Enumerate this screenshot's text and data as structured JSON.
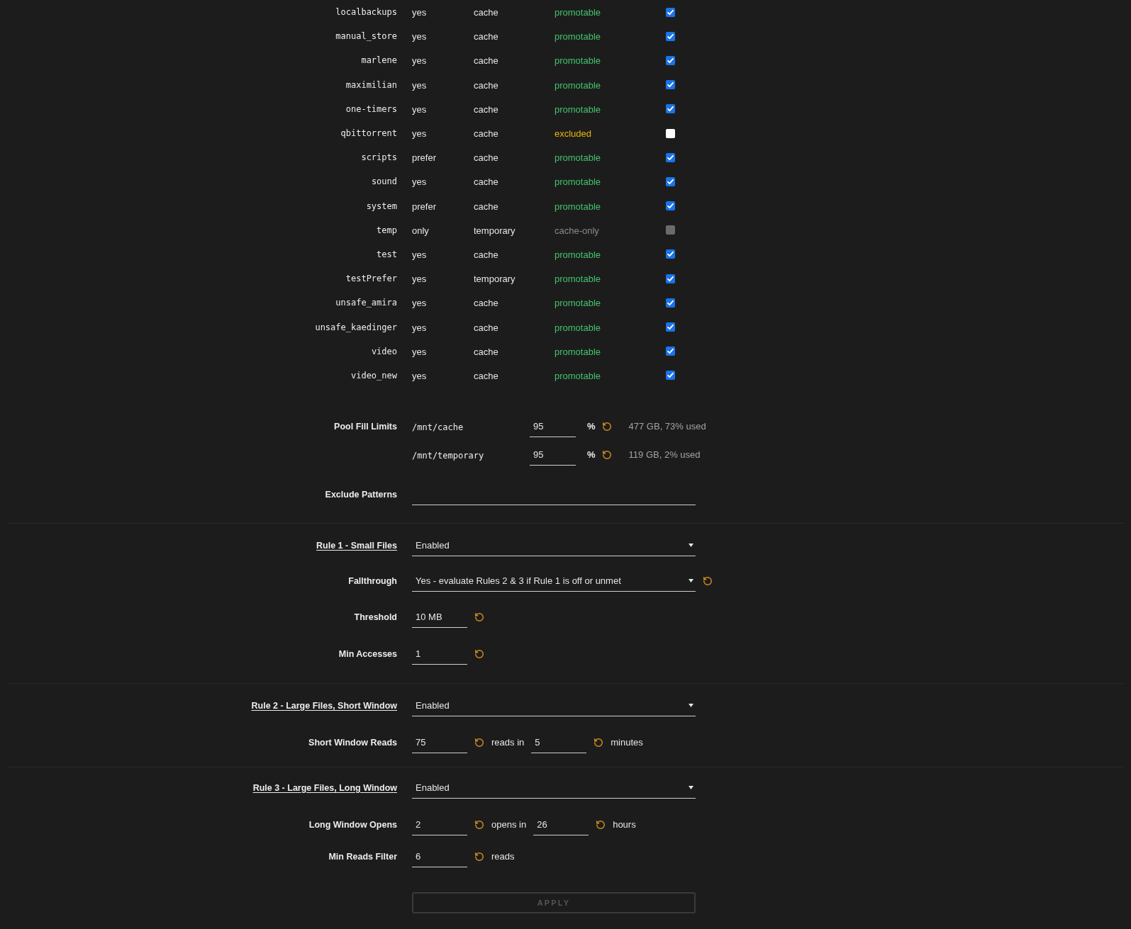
{
  "shares": [
    {
      "name": "localbackups",
      "use_cache": "yes",
      "pool": "cache",
      "status": "promotable",
      "color": "#42c46a",
      "checked": true,
      "disabled": false
    },
    {
      "name": "manual_store",
      "use_cache": "yes",
      "pool": "cache",
      "status": "promotable",
      "color": "#42c46a",
      "checked": true,
      "disabled": false
    },
    {
      "name": "marlene",
      "use_cache": "yes",
      "pool": "cache",
      "status": "promotable",
      "color": "#42c46a",
      "checked": true,
      "disabled": false
    },
    {
      "name": "maximilian",
      "use_cache": "yes",
      "pool": "cache",
      "status": "promotable",
      "color": "#42c46a",
      "checked": true,
      "disabled": false
    },
    {
      "name": "one-timers",
      "use_cache": "yes",
      "pool": "cache",
      "status": "promotable",
      "color": "#42c46a",
      "checked": true,
      "disabled": false
    },
    {
      "name": "qbittorrent",
      "use_cache": "yes",
      "pool": "cache",
      "status": "excluded",
      "color": "#e8b80c",
      "checked": false,
      "disabled": false
    },
    {
      "name": "scripts",
      "use_cache": "prefer",
      "pool": "cache",
      "status": "promotable",
      "color": "#42c46a",
      "checked": true,
      "disabled": false
    },
    {
      "name": "sound",
      "use_cache": "yes",
      "pool": "cache",
      "status": "promotable",
      "color": "#42c46a",
      "checked": true,
      "disabled": false
    },
    {
      "name": "system",
      "use_cache": "prefer",
      "pool": "cache",
      "status": "promotable",
      "color": "#42c46a",
      "checked": true,
      "disabled": false
    },
    {
      "name": "temp",
      "use_cache": "only",
      "pool": "temporary",
      "status": "cache-only",
      "color": "#8a8a8a",
      "checked": false,
      "disabled": true
    },
    {
      "name": "test",
      "use_cache": "yes",
      "pool": "cache",
      "status": "promotable",
      "color": "#42c46a",
      "checked": true,
      "disabled": false
    },
    {
      "name": "testPrefer",
      "use_cache": "yes",
      "pool": "temporary",
      "status": "promotable",
      "color": "#42c46a",
      "checked": true,
      "disabled": false
    },
    {
      "name": "unsafe_amira",
      "use_cache": "yes",
      "pool": "cache",
      "status": "promotable",
      "color": "#42c46a",
      "checked": true,
      "disabled": false
    },
    {
      "name": "unsafe_kaedinger",
      "use_cache": "yes",
      "pool": "cache",
      "status": "promotable",
      "color": "#42c46a",
      "checked": true,
      "disabled": false
    },
    {
      "name": "video",
      "use_cache": "yes",
      "pool": "cache",
      "status": "promotable",
      "color": "#42c46a",
      "checked": true,
      "disabled": false
    },
    {
      "name": "video_new",
      "use_cache": "yes",
      "pool": "cache",
      "status": "promotable",
      "color": "#42c46a",
      "checked": true,
      "disabled": false
    }
  ],
  "pool_fill_limits": {
    "label": "Pool Fill Limits",
    "pools": [
      {
        "path": "/mnt/cache",
        "value": "95",
        "unit": "%",
        "usage": "477 GB, 73% used"
      },
      {
        "path": "/mnt/temporary",
        "value": "95",
        "unit": "%",
        "usage": "119 GB, 2% used"
      }
    ]
  },
  "exclude_patterns": {
    "label": "Exclude Patterns"
  },
  "rules": [
    {
      "rows": [
        {
          "kind": "heading",
          "label": "Rule 1 - Small Files",
          "value": "Enabled",
          "reset": false
        },
        {
          "kind": "select",
          "label": "Fallthrough",
          "value": "Yes - evaluate Rules 2 & 3 if Rule 1 is off or unmet",
          "reset": true
        },
        {
          "kind": "inputs",
          "label": "Threshold",
          "inputs": [
            {
              "value": "10 MB"
            }
          ]
        },
        {
          "kind": "inputs",
          "label": "Min Accesses",
          "inputs": [
            {
              "value": "1"
            }
          ]
        }
      ]
    },
    {
      "rows": [
        {
          "kind": "heading",
          "label": "Rule 2 - Large Files, Short Window",
          "value": "Enabled",
          "reset": false
        },
        {
          "kind": "inputs",
          "label": "Short Window Reads",
          "inputs": [
            {
              "value": "75",
              "suffix": "reads in"
            },
            {
              "value": "5",
              "suffix": "minutes"
            }
          ]
        }
      ]
    },
    {
      "rows": [
        {
          "kind": "heading",
          "label": "Rule 3 - Large Files, Long Window",
          "value": "Enabled",
          "reset": false
        },
        {
          "kind": "inputs",
          "label": "Long Window Opens",
          "inputs": [
            {
              "value": "2",
              "suffix": "opens in"
            },
            {
              "value": "26",
              "suffix": "hours"
            }
          ]
        },
        {
          "kind": "inputs",
          "label": "Min Reads Filter",
          "inputs": [
            {
              "value": "6",
              "suffix": "reads"
            }
          ]
        }
      ]
    }
  ],
  "apply_button": {
    "label": "APPLY",
    "disabled": true
  }
}
